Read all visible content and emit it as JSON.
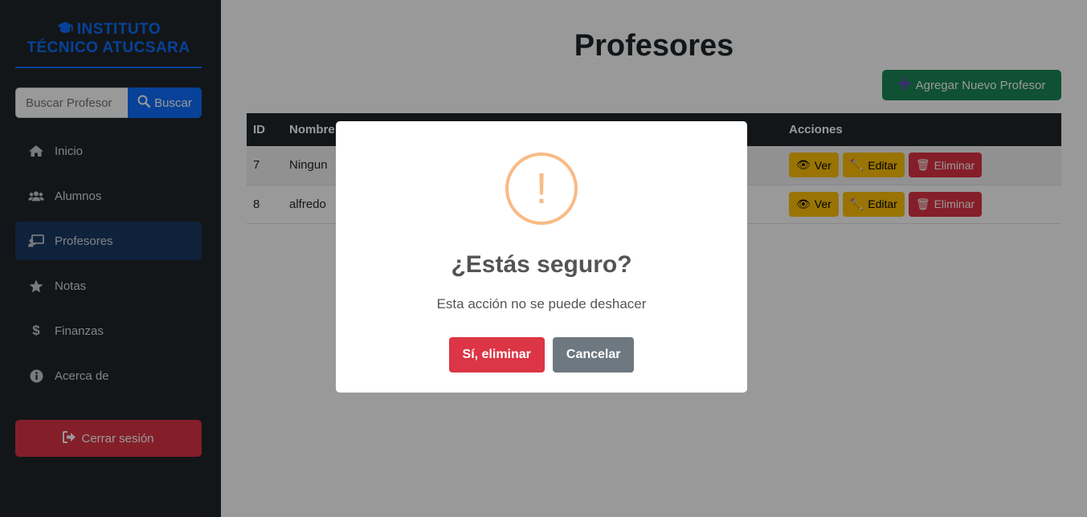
{
  "sidebar": {
    "brand_line1": "INSTITUTO",
    "brand_line2": "TÉCNICO ATUCSARA",
    "search_placeholder": "Buscar Profesor",
    "search_button": "Buscar",
    "items": [
      {
        "label": "Inicio",
        "icon": "home-icon"
      },
      {
        "label": "Alumnos",
        "icon": "users-icon"
      },
      {
        "label": "Profesores",
        "icon": "chalkboard-teacher-icon",
        "active": true
      },
      {
        "label": "Notas",
        "icon": "star-icon"
      },
      {
        "label": "Finanzas",
        "icon": "dollar-icon"
      },
      {
        "label": "Acerca de",
        "icon": "info-icon"
      }
    ],
    "logout": "Cerrar sesión"
  },
  "main": {
    "title": "Profesores",
    "add_button": "Agregar Nuevo Profesor",
    "table": {
      "headers": [
        "ID",
        "Nombre",
        "Acciones"
      ],
      "rows": [
        {
          "id": "7",
          "name": "Ningun"
        },
        {
          "id": "8",
          "name": "alfredo"
        }
      ],
      "actions": {
        "view": "Ver",
        "edit": "Editar",
        "delete": "Eliminar"
      }
    }
  },
  "modal": {
    "icon": "!",
    "title": "¿Estás seguro?",
    "text": "Esta acción no se puede deshacer",
    "confirm": "Sí, eliminar",
    "cancel": "Cancelar"
  },
  "colors": {
    "brand": "#0d6efd",
    "sidebar": "#212529",
    "danger": "#dc3545",
    "warning": "#ffc107",
    "success": "#198754",
    "secondary": "#6e7881"
  }
}
